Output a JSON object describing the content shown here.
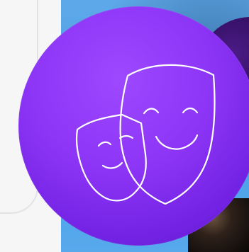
{
  "canvas": {
    "background": "#f6f6f7"
  },
  "decor": {
    "panel_outline_color": "#e3e3e6",
    "backdrop_color": "#4aa0e4",
    "main_circle_color": "#8d35f6",
    "secondary_circle_color": "#2a0b54",
    "icon_stroke_color": "#ffffff"
  },
  "icons": {
    "main": "theater-masks-icon"
  }
}
